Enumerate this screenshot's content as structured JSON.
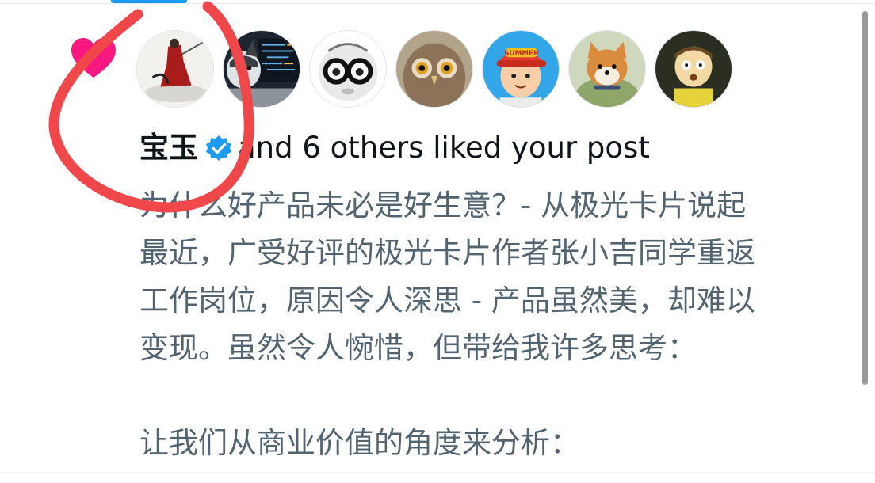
{
  "notification": {
    "type": "like",
    "user_name": "宝玉",
    "verified": true,
    "headline_rest": "and 6 others liked your post",
    "avatars": [
      {
        "name": "avatar-baoyu"
      },
      {
        "name": "avatar-husky-laptop"
      },
      {
        "name": "avatar-baby-glasses"
      },
      {
        "name": "avatar-owl"
      },
      {
        "name": "avatar-summer-cap"
      },
      {
        "name": "avatar-shiba"
      },
      {
        "name": "avatar-cartoon"
      }
    ]
  },
  "post": {
    "lines": [
      "为什么好产品未必是好生意？- 从极光卡片说起",
      "最近，广受好评的极光卡片作者张小吉同学重返",
      "工作岗位，原因令人深思 - 产品虽然美，却难以",
      "变现。虽然令人惋惜，但带给我许多思考：",
      "",
      "让我们从商业价值的角度来分析："
    ]
  },
  "colors": {
    "like_pink": "#f91880",
    "verified_blue": "#1d9bf0",
    "annotation_red": "#f0484a",
    "body_gray": "#536471"
  }
}
